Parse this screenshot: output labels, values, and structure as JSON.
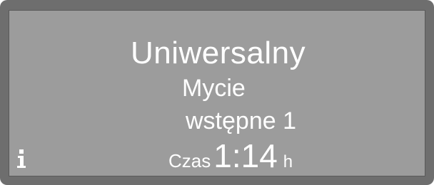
{
  "display": {
    "program": "Uniwersalny",
    "phase_line1": "Mycie",
    "phase_line2": "wstępne 1",
    "time_label": "Czas",
    "time_value": "1:14",
    "time_unit": "h"
  },
  "colors": {
    "bezel": "#6e6e6e",
    "screen": "#9c9c9c",
    "text": "#ffffff"
  },
  "icons": {
    "info": "info-icon"
  }
}
